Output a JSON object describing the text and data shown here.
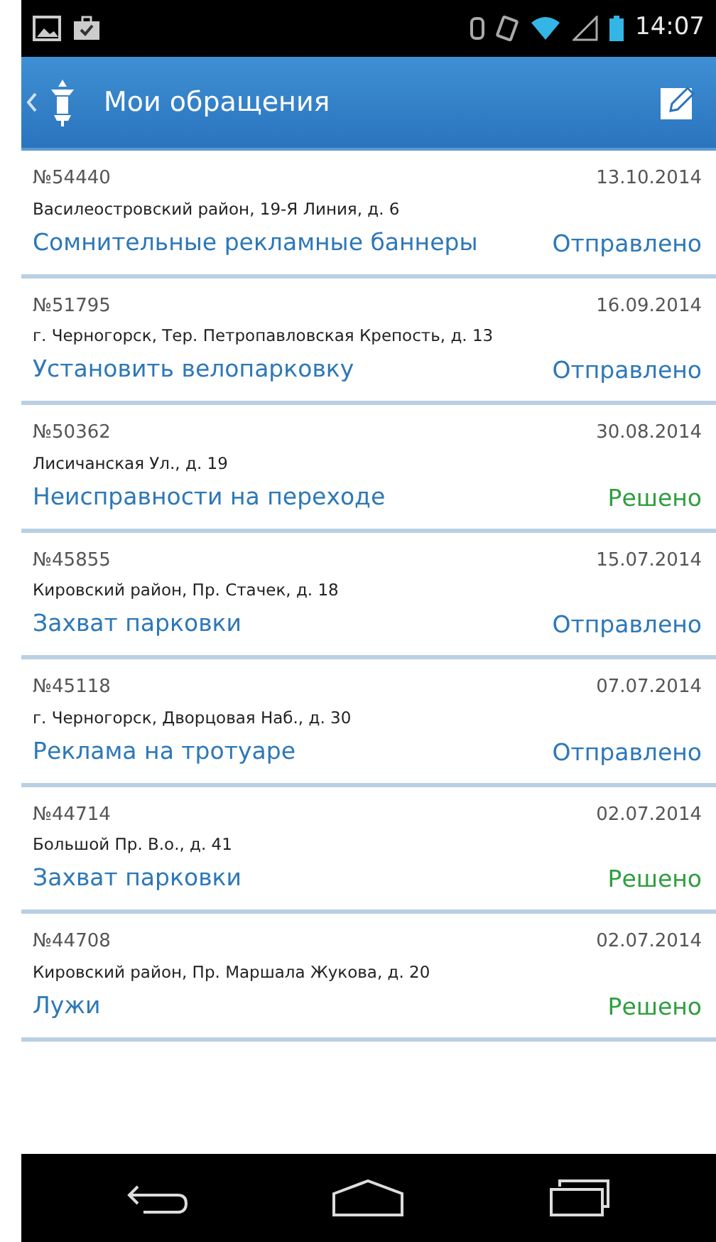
{
  "status_bar": {
    "time": "14:07"
  },
  "app_bar": {
    "title": "Мои обращения"
  },
  "requests": [
    {
      "number": "№54440",
      "date": "13.10.2014",
      "address": "Василеостровский район,  19-Я Линия, д. 6",
      "subject": "Сомнительные рекламные баннеры",
      "status": "Отправлено",
      "kind": "sent"
    },
    {
      "number": "№51795",
      "date": "16.09.2014",
      "address": "г. Черногорск,  Тер. Петропавловская Крепость, д. 13",
      "subject": "Установить велопарковку",
      "status": "Отправлено",
      "kind": "sent"
    },
    {
      "number": "№50362",
      "date": "30.08.2014",
      "address": "Лисичанская Ул., д. 19",
      "subject": "Неисправности на переходе",
      "status": "Решено",
      "kind": "resolved"
    },
    {
      "number": "№45855",
      "date": "15.07.2014",
      "address": "Кировский район,  Пр. Стачек, д. 18",
      "subject": "Захват парковки",
      "status": "Отправлено",
      "kind": "sent"
    },
    {
      "number": "№45118",
      "date": "07.07.2014",
      "address": "г. Черногорск,  Дворцовая Наб., д. 30",
      "subject": "Реклама на тротуаре",
      "status": "Отправлено",
      "kind": "sent"
    },
    {
      "number": "№44714",
      "date": "02.07.2014",
      "address": "Большой Пр. В.о., д. 41",
      "subject": "Захват парковки",
      "status": "Решено",
      "kind": "resolved"
    },
    {
      "number": "№44708",
      "date": "02.07.2014",
      "address": "Кировский район,  Пр. Маршала Жукова, д. 20",
      "subject": "Лужи",
      "status": "Решено",
      "kind": "resolved"
    }
  ]
}
